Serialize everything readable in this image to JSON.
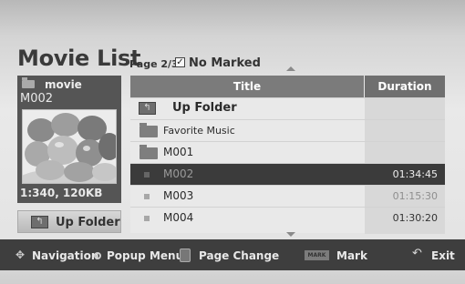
{
  "header": {
    "title": "Movie List",
    "page_info": "Page 2/3",
    "marked_status": "No Marked"
  },
  "preview": {
    "folder": "movie",
    "name": "M002",
    "info": "1:340, 120KB",
    "thumbnail": "apples-photo"
  },
  "up_folder_button": {
    "label": "Up Folder"
  },
  "table": {
    "columns": {
      "title": "Title",
      "duration": "Duration"
    },
    "rows": [
      {
        "icon": "up-folder-icon",
        "name": "Up Folder",
        "duration": ""
      },
      {
        "icon": "folder-icon",
        "name": "Favorite Music",
        "duration": ""
      },
      {
        "icon": "folder-icon",
        "name": "M001",
        "duration": ""
      },
      {
        "icon": "file-icon",
        "name": "M002",
        "duration": "01:34:45",
        "selected": true
      },
      {
        "icon": "file-icon",
        "name": "M003",
        "duration": "01:15:30"
      },
      {
        "icon": "file-icon",
        "name": "M004",
        "duration": "01:30:20"
      }
    ]
  },
  "bottom_bar": {
    "navigation": "Navigation",
    "popup_menu": "Popup Menu",
    "page_change": "Page Change",
    "mark_key": "MARK",
    "mark": "Mark",
    "exit": "Exit"
  },
  "colors": {
    "header_bar": "#7b7b7b",
    "selected_row": "#3b3b3b",
    "bottom_bar": "#3e3e3e"
  }
}
